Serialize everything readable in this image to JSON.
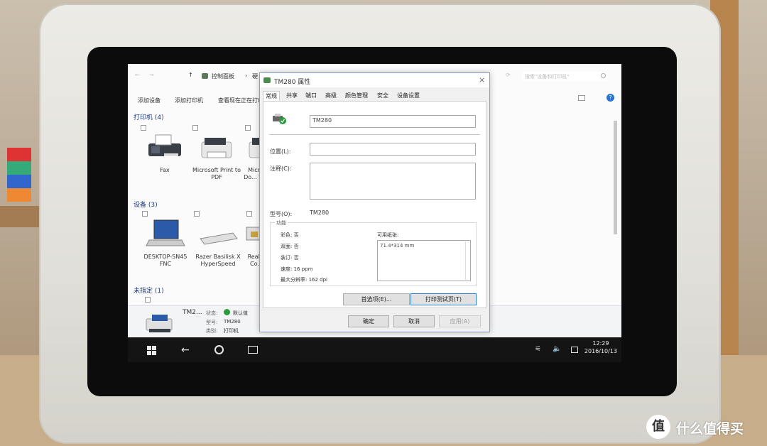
{
  "explorer": {
    "nav": {
      "back": "←",
      "forward": "→",
      "up": "↑",
      "address": "控制面板",
      "address_sep": "›",
      "address_more": "硬",
      "search_placeholder": "搜索\"设备和打印机\"",
      "refresh": "⟳"
    },
    "commands": {
      "add_device": "添加设备",
      "add_printer": "添加打印机",
      "see_whats_printing": "查看现在正在打印"
    },
    "sections": {
      "printers": {
        "title": "打印机 (4)",
        "items": [
          {
            "label": "Fax",
            "icon": "fax-icon"
          },
          {
            "label": "Microsoft Print to PDF",
            "icon": "printer-icon"
          },
          {
            "label": "Micr... Do... W...",
            "icon": "printer-icon"
          }
        ]
      },
      "devices": {
        "title": "设备 (3)",
        "items": [
          {
            "label": "DESKTOP-SN45 FNC",
            "icon": "laptop-icon"
          },
          {
            "label": "Razer Basilisk X HyperSpeed",
            "icon": "keyboard-icon"
          },
          {
            "label": "Real... Co...",
            "icon": "network-adapter-icon"
          }
        ]
      },
      "unspecified": {
        "title": "未指定 (1)"
      }
    },
    "details": {
      "name": "TM2...",
      "status_label": "状态:",
      "status_value": "默认值",
      "model_label": "型号:",
      "model_value": "TM280",
      "category_label": "类别:",
      "category_value": "打印机"
    }
  },
  "dialog": {
    "title": "TM280 属性",
    "close": "×",
    "tabs": [
      "常规",
      "共享",
      "端口",
      "高级",
      "颜色管理",
      "安全",
      "设备设置"
    ],
    "active_tab": "常规",
    "printer_name": "TM280",
    "location_label": "位置(L):",
    "location_value": "",
    "comment_label": "注释(C):",
    "comment_value": "",
    "model_label": "型号(O):",
    "model_value": "TM280",
    "features_title": "功能",
    "features": {
      "color": "彩色: 否",
      "duplex": "双面: 否",
      "staple": "装订: 否",
      "speed": "速度: 16 ppm",
      "resolution": "最大分辨率: 162 dpi"
    },
    "paper_label": "可用纸张:",
    "paper_sizes": [
      "71.4*314 mm"
    ],
    "preferences_button": "首选项(E)...",
    "test_page_button": "打印测试页(T)",
    "ok_button": "确定",
    "cancel_button": "取消",
    "apply_button": "应用(A)"
  },
  "taskbar": {
    "time": "12:29",
    "date": "2016/10/13"
  },
  "watermark": {
    "logo": "值",
    "text": "什么值得买"
  }
}
